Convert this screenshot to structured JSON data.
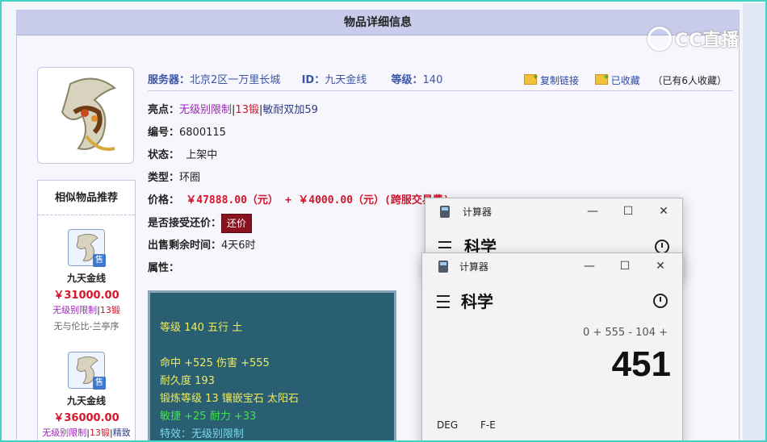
{
  "page": {
    "title": "物品详细信息"
  },
  "item": {
    "server_label": "服务器：",
    "server_value": "北京2区一万里长城",
    "id_label": "ID：",
    "id_value": "九天金线",
    "level_label": "等级：",
    "level_value": "140",
    "copy_link": "复制链接",
    "collected": "已收藏",
    "collect_count": "（已有6人收藏）",
    "highlights_label": "亮点：",
    "highlight_1": "无级别限制",
    "sep": "|",
    "highlight_2": "13锻",
    "highlight_3": "敏耐双加59",
    "number_label": "编号：",
    "number_value": "6800115",
    "status_label": "状态：",
    "status_value": "上架中",
    "type_label": "类型：",
    "type_value": "环圈",
    "price_label": "价格：",
    "price_value": "￥47888.00（元）",
    "price_plus": "+",
    "price_fee": "￥4000.00（元）",
    "price_fee_note": "(跨服交易费)",
    "counter_label": "是否接受还价：",
    "counter_button": "还价",
    "remaining_label": "出售剩余时间：",
    "remaining_value": "4天6时",
    "attrs_label": "属性："
  },
  "attributes": {
    "line1": "等级 140 五行 土",
    "line2": "命中 +525 伤害 +555",
    "line3": "耐久度 193",
    "line4": "锻炼等级 13 镶嵌宝石 太阳石",
    "line5": "敏捷 +25 耐力 +33",
    "line6": "特效：无级别限制"
  },
  "similar": {
    "title": "相似物品推荐",
    "sale_tag": "售",
    "items": [
      {
        "name": "九天金线",
        "price": "￥31000.00",
        "tag1": "无级别限制",
        "sep": "|",
        "tag2": "13锻",
        "seller": "无与伦比-兰亭序"
      },
      {
        "name": "九天金线",
        "price": "￥36000.00",
        "tag1": "无级别限制",
        "sep": "|",
        "tag2": "13锻",
        "sep2": "|",
        "tag3": "精致"
      }
    ]
  },
  "watermark": {
    "text": "CC直播"
  },
  "calculator_back": {
    "app_name": "计算器",
    "mode": "科学",
    "minimize": "—",
    "maximize": "☐",
    "close": "✕"
  },
  "calculator_front": {
    "app_name": "计算器",
    "mode": "科学",
    "minimize": "—",
    "maximize": "☐",
    "close": "✕",
    "expression": "0 + 555 - 104 +",
    "result": "451",
    "deg_label": "DEG",
    "fe_label": "F-E"
  },
  "colors": {
    "accent_red": "#d4142a",
    "label_blue": "#3a55a8",
    "panel_teal": "#2a5e72",
    "title_bar": "#c8cbe9"
  }
}
